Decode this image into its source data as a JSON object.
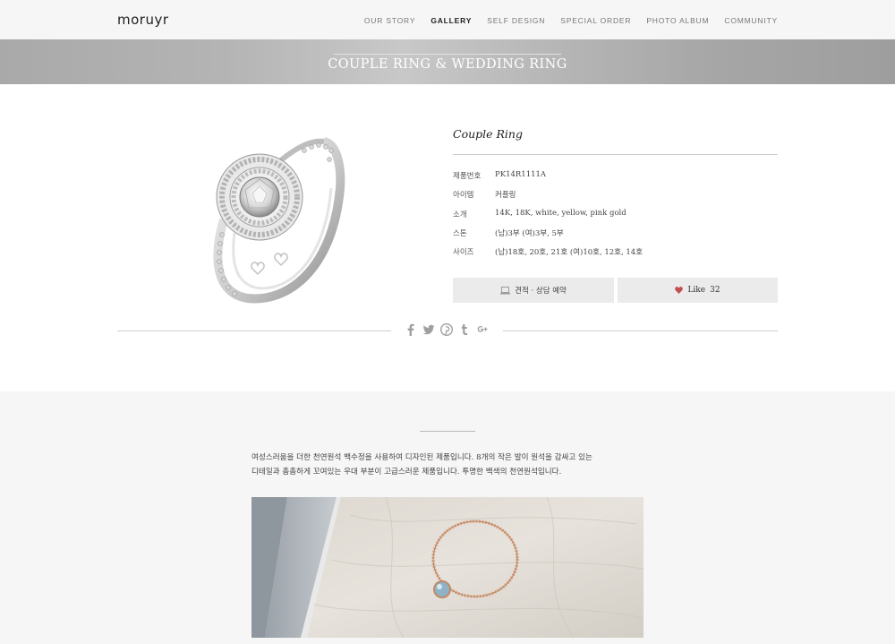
{
  "header": {
    "logo": "moruyr",
    "nav": [
      {
        "label": "OUR STORY",
        "active": false
      },
      {
        "label": "GALLERY",
        "active": true
      },
      {
        "label": "SELF DESIGN",
        "active": false
      },
      {
        "label": "SPECIAL ORDER",
        "active": false
      },
      {
        "label": "PHOTO ALBUM",
        "active": false
      },
      {
        "label": "COMMUNITY",
        "active": false
      }
    ]
  },
  "banner": {
    "title": "COUPLE RING & WEDDING RING"
  },
  "product": {
    "name": "Couple Ring",
    "specs": [
      {
        "label": "제품번호",
        "value": "PK14R1111A"
      },
      {
        "label": "아이템",
        "value": "커플링"
      },
      {
        "label": "소개",
        "value": "14K, 18K, white, yellow, pink gold"
      },
      {
        "label": "스톤",
        "value": "(남)3부  (여)3부, 5부"
      },
      {
        "label": "사이즈",
        "value": "(남)18호, 20호, 21호 (여)10호, 12호, 14호"
      }
    ],
    "consult_label": "견적 · 상담 예약",
    "like_label": "Like",
    "like_count": "32"
  },
  "social": [
    "facebook-icon",
    "twitter-icon",
    "pinterest-icon",
    "tumblr-icon",
    "google-plus-icon"
  ],
  "description": {
    "line1": "여성스러움을 더한 천연원석 백수정을 사용하여 디자인된 제품입니다. 8개의 작은 발이 원석을 감싸고 있는",
    "line2": "디테일과 촘촘하게 꼬여있는 우대 부분이 고급스러운 제품입니다. 투명한 백색의 천연원석입니다."
  },
  "colors": {
    "header_bg": "#f6f6f6",
    "banner": "#b2b2b2",
    "button_bg": "#ebebeb",
    "heart": "#c0504d"
  }
}
